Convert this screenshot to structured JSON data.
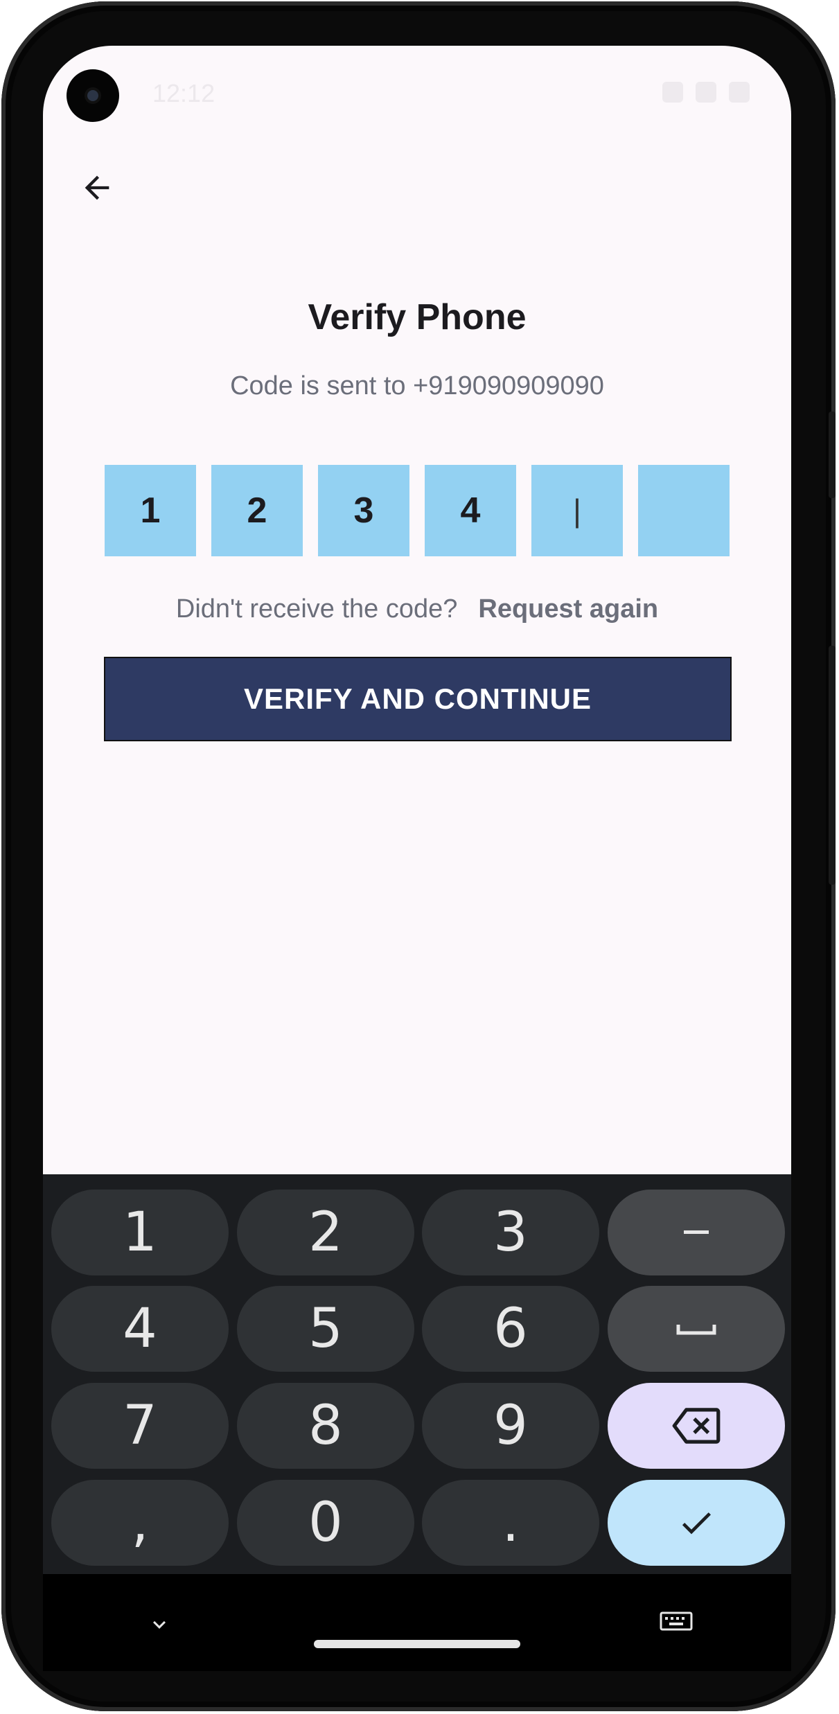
{
  "status_bar": {
    "time": "12:12"
  },
  "header": {
    "title": "Verify Phone",
    "subtitle": "Code is sent to +919090909090"
  },
  "otp": {
    "digits": [
      "1",
      "2",
      "3",
      "4",
      "",
      ""
    ],
    "cursor": "|"
  },
  "resend": {
    "prompt": "Didn't receive the code?",
    "link": "Request again"
  },
  "verify_button": {
    "label": "VERIFY AND CONTINUE"
  },
  "keyboard": {
    "keys": [
      "1",
      "2",
      "3",
      "–",
      "4",
      "5",
      "6",
      "␣",
      "7",
      "8",
      "9",
      "backspace",
      ",",
      "0",
      ".",
      "done"
    ]
  },
  "colors": {
    "otp_box": "#93d1f2",
    "button": "#2e3a63",
    "background": "#fcf8fb",
    "keyboard": "#1b1d20"
  }
}
